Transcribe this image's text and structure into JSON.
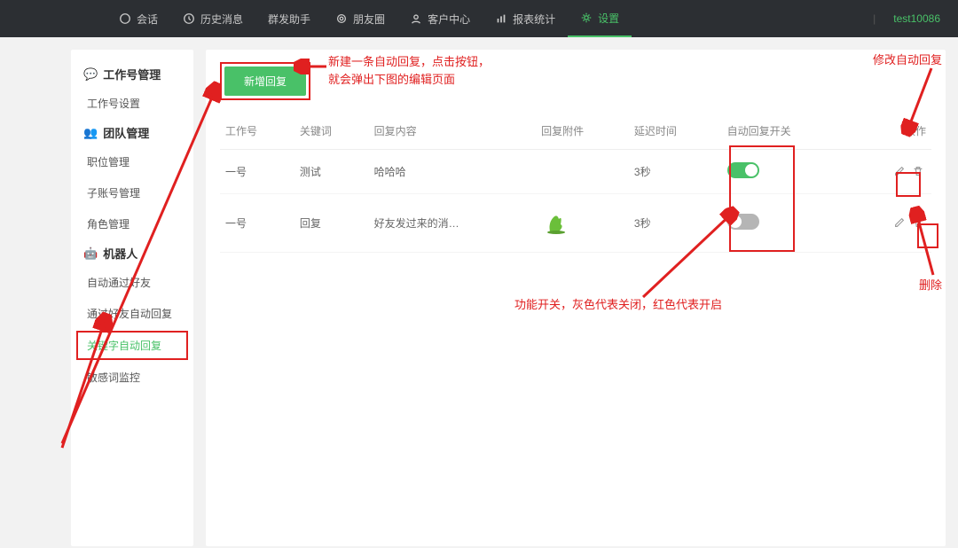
{
  "topnav": {
    "items": [
      {
        "icon": "chat",
        "label": "会话"
      },
      {
        "icon": "clock",
        "label": "历史消息"
      },
      {
        "icon": "",
        "label": "群发助手"
      },
      {
        "icon": "moments",
        "label": "朋友圈"
      },
      {
        "icon": "person",
        "label": "客户中心"
      },
      {
        "icon": "bars",
        "label": "报表统计"
      },
      {
        "icon": "gear",
        "label": "设置"
      }
    ],
    "active_index": 6,
    "right": {
      "icon": "db",
      "divider": "|",
      "user_icon": "user",
      "username": "test10086"
    }
  },
  "sidebar": {
    "groups": [
      {
        "icon": "wechat",
        "title": "工作号管理",
        "items": [
          "工作号设置"
        ]
      },
      {
        "icon": "team",
        "title": "团队管理",
        "items": [
          "职位管理",
          "子账号管理",
          "角色管理"
        ]
      },
      {
        "icon": "robot",
        "title": "机器人",
        "items": [
          "自动通过好友",
          "通过好友自动回复",
          "关键字自动回复",
          "敏感词监控"
        ],
        "active_index": 2
      }
    ]
  },
  "main": {
    "add_button": "新增回复",
    "columns": [
      "工作号",
      "关键词",
      "回复内容",
      "回复附件",
      "延迟时间",
      "自动回复开关",
      "操作"
    ],
    "rows": [
      {
        "account": "一号",
        "keyword": "测试",
        "content": "哈哈哈",
        "attachment": "",
        "delay": "3秒",
        "toggle": "on"
      },
      {
        "account": "一号",
        "keyword": "回复",
        "content": "好友发过来的消…",
        "attachment": "image",
        "delay": "3秒",
        "toggle": "off"
      }
    ]
  },
  "annotations": {
    "create": "新建一条自动回复，点击按钮，\n就会弹出下图的编辑页面",
    "edit": "修改自动回复",
    "delete": "删除",
    "switch": "功能开关，灰色代表关闭，红色代表开启"
  }
}
